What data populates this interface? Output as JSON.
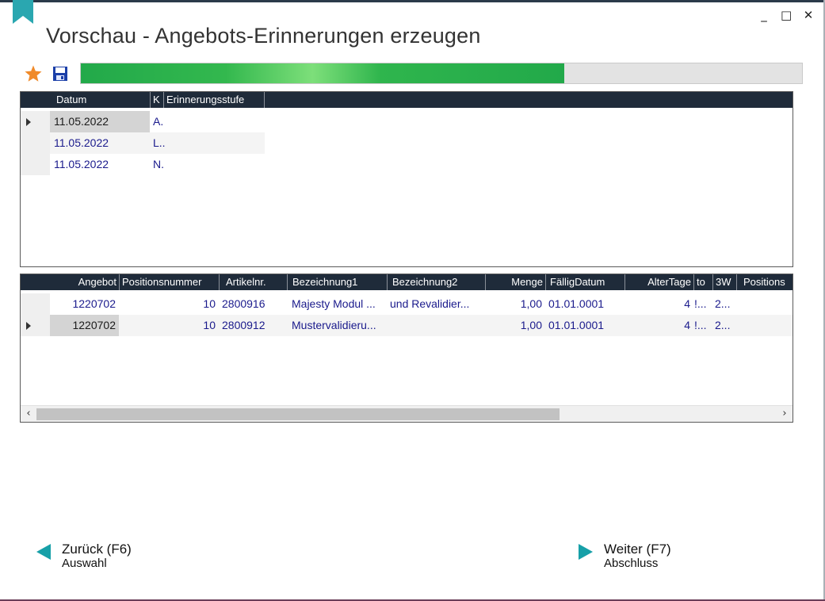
{
  "window": {
    "title": "Vorschau - Angebots-Erinnerungen erzeugen",
    "minimize": "_",
    "maximize": "□",
    "close": "✕"
  },
  "toolbar": {
    "favorite_icon": "star-icon",
    "save_icon": "save-icon"
  },
  "progress": {
    "value_percent": 67
  },
  "reminders": {
    "columns": [
      "Datum",
      "K",
      "Erinnerungsstufe"
    ],
    "rows": [
      {
        "datum": "11.05.2022",
        "k": "A.",
        "selected": true
      },
      {
        "datum": "11.05.2022",
        "k": "L..",
        "selected": false
      },
      {
        "datum": "11.05.2022",
        "k": "N.",
        "selected": false
      }
    ]
  },
  "positions": {
    "columns": [
      "Angebot",
      "Positionsnummer",
      "Artikelnr.",
      "Bezeichnung1",
      "Bezeichnung2",
      "Menge",
      "FälligDatum",
      "AlterTage",
      "to",
      "3W",
      "Positions"
    ],
    "rows": [
      {
        "angebot": "1220702",
        "positionsnummer": "10",
        "artikelnr": "2800916",
        "bezeichnung1": "Majesty Modul ...",
        "bezeichnung2": "und Revalidier...",
        "menge": "1,00",
        "faelligdatum": "01.01.0001",
        "altertage": "4",
        "to": "!...",
        "w3": "2...",
        "selected": false
      },
      {
        "angebot": "1220702",
        "positionsnummer": "10",
        "artikelnr": "2800912",
        "bezeichnung1": "Mustervalidieru...",
        "bezeichnung2": "",
        "menge": "1,00",
        "faelligdatum": "01.01.0001",
        "altertage": "4",
        "to": "!...",
        "w3": "2...",
        "selected": true
      }
    ]
  },
  "navigation": {
    "back": {
      "label": "Zurück (F6)",
      "sub": "Auswahl"
    },
    "next": {
      "label": "Weiter (F7)",
      "sub": "Abschluss"
    }
  },
  "colors": {
    "accent": "#17a0a8",
    "progress": "#22a94a",
    "header": "#1f2b3a",
    "link_text": "#1a1a8c"
  }
}
